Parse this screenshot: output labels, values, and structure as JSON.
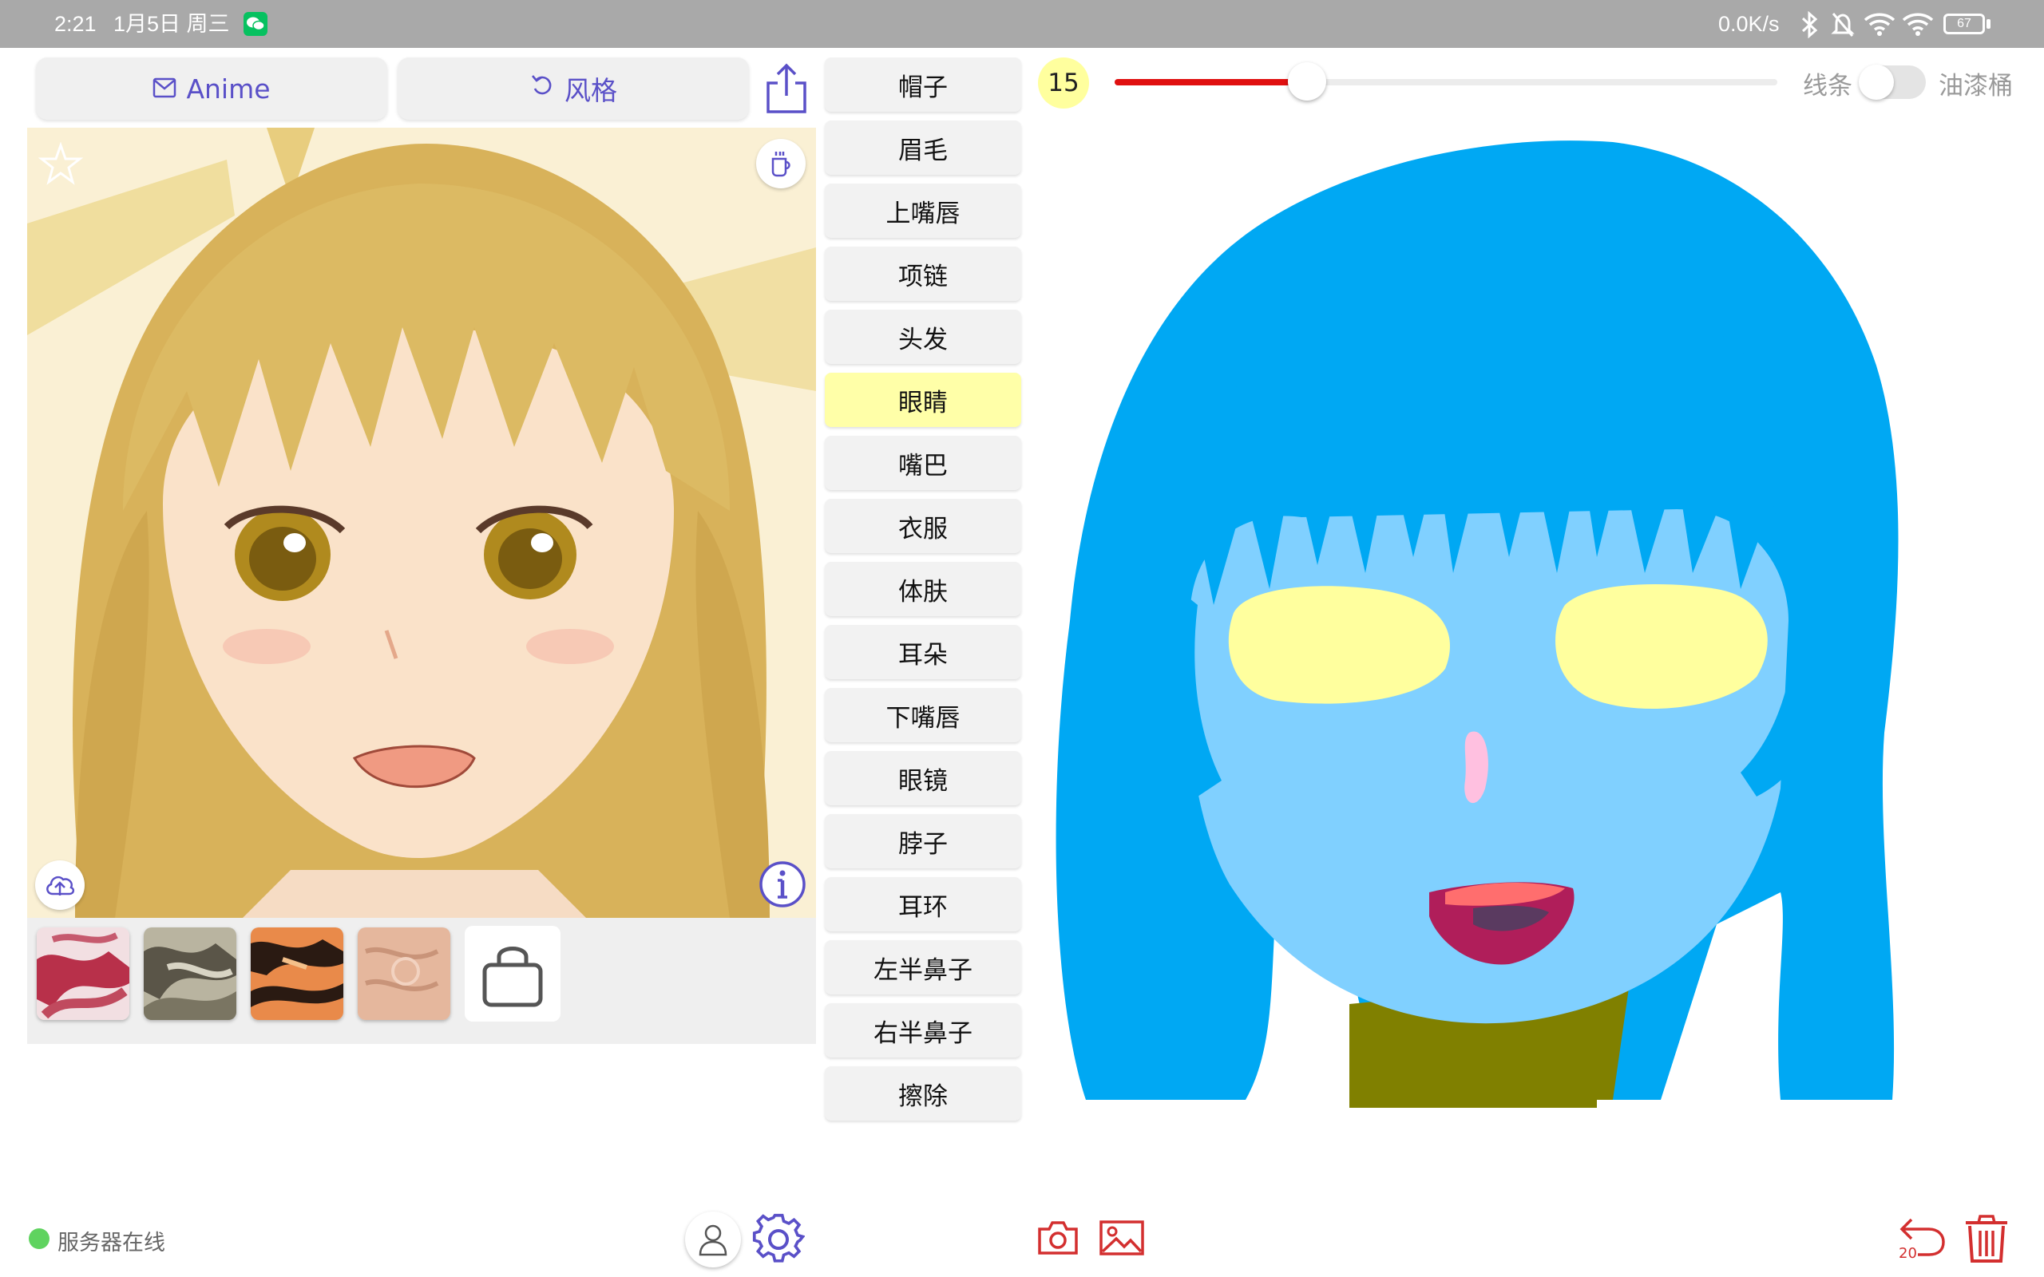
{
  "status_bar": {
    "time": "2:21",
    "date": "1月5日 周三",
    "net_speed": "0.0K/s",
    "battery": "67"
  },
  "header": {
    "anime_label": "Anime",
    "style_label": "风格"
  },
  "parts": [
    {
      "label": "帽子"
    },
    {
      "label": "眉毛"
    },
    {
      "label": "上嘴唇"
    },
    {
      "label": "项链"
    },
    {
      "label": "头发"
    },
    {
      "label": "眼睛",
      "selected": true
    },
    {
      "label": "嘴巴"
    },
    {
      "label": "衣服"
    },
    {
      "label": "体肤"
    },
    {
      "label": "耳朵"
    },
    {
      "label": "下嘴唇"
    },
    {
      "label": "眼镜"
    },
    {
      "label": "脖子"
    },
    {
      "label": "耳环"
    },
    {
      "label": "左半鼻子"
    },
    {
      "label": "右半鼻子"
    },
    {
      "label": "擦除"
    }
  ],
  "brush": {
    "size": "15",
    "slider_fraction": 0.29,
    "slider_color": "#e01010",
    "line_label": "线条",
    "fill_label": "油漆桶",
    "fill_mode_on": false
  },
  "footer": {
    "server_status": "服务器在线",
    "server_color": "#5fd35f",
    "undo_count": "20"
  },
  "colors": {
    "accent": "#5a50c8",
    "danger": "#d32f2f",
    "hair": "#00a8f3",
    "skin": "#80d0ff",
    "eyes": "#ffff9e",
    "selected_part": "#ffffa8"
  },
  "icons": [
    "mail-icon",
    "refresh-icon",
    "share-icon",
    "star-icon",
    "coffee-icon",
    "cloud-upload-icon",
    "info-icon",
    "bag-icon",
    "wechat-icon",
    "bluetooth-icon",
    "bell-off-icon",
    "wifi-icon",
    "battery-icon",
    "user-icon",
    "gear-icon",
    "camera-icon",
    "image-icon",
    "undo-icon",
    "trash-icon"
  ]
}
